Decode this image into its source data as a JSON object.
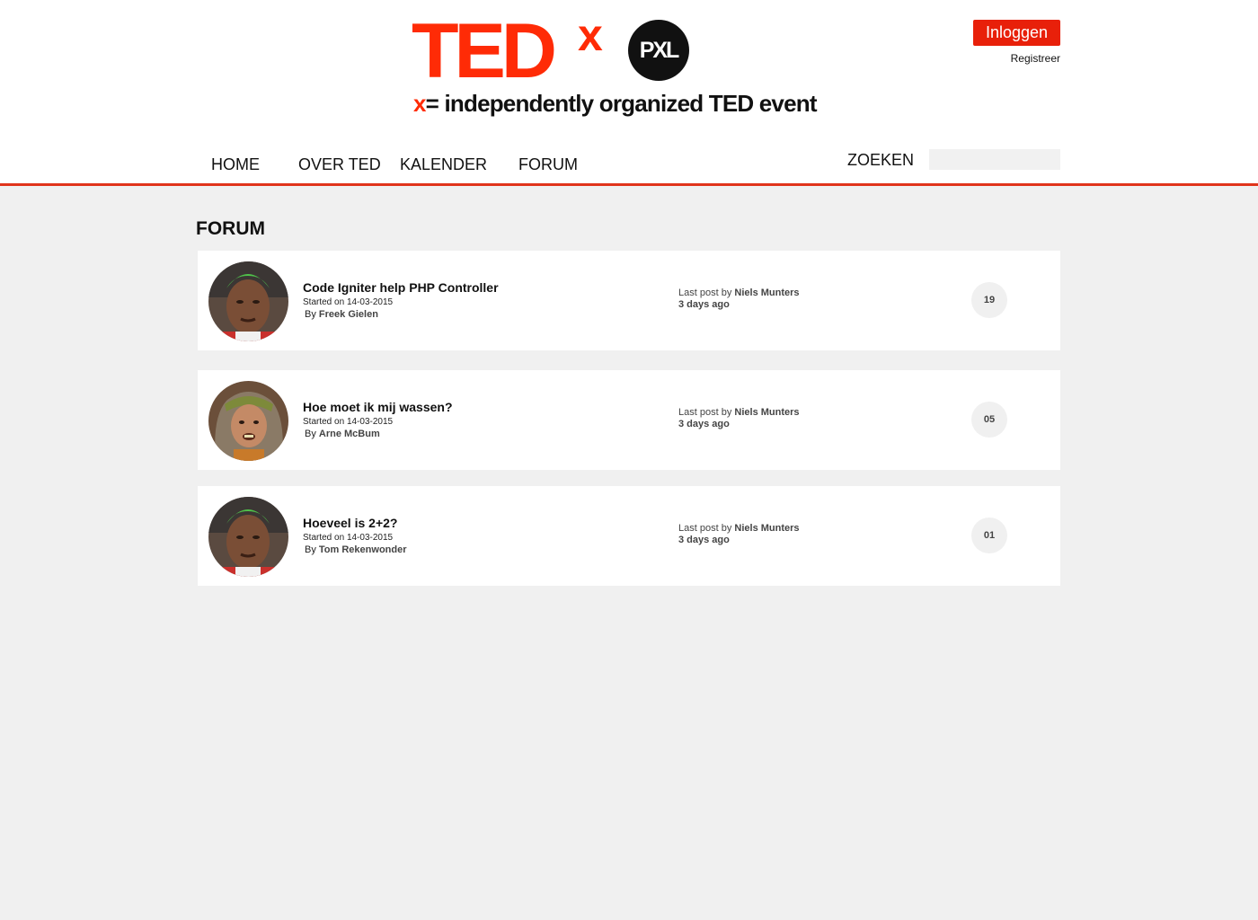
{
  "brand": {
    "logo_main": "TED",
    "logo_superscript": "x",
    "logo_badge": "PXL",
    "tagline_x": "x",
    "tagline_rest": "= independently organized TED event",
    "accent_color": "#ff2b06"
  },
  "auth": {
    "login_label": "Inloggen",
    "register_label": "Registreer"
  },
  "nav": {
    "items": [
      {
        "label": "HOME"
      },
      {
        "label": "OVER TED"
      },
      {
        "label": "KALENDER"
      },
      {
        "label": "FORUM"
      }
    ],
    "search_label": "ZOEKEN",
    "search_value": ""
  },
  "page": {
    "title": "FORUM"
  },
  "threads": [
    {
      "title": "Code Igniter help PHP Controller",
      "started_prefix": "Started on",
      "started_date": "14-03-2015",
      "by_prefix": "By",
      "author": "Freek Gielen",
      "last_post_prefix": "Last post by",
      "last_post_author": "Niels Munters",
      "last_post_ago": "3 days ago",
      "replies": "19",
      "avatar": "green-hair-man"
    },
    {
      "title": "Hoe moet ik mij wassen?",
      "started_prefix": "Started on",
      "started_date": "14-03-2015",
      "by_prefix": "By",
      "author": "Arne McBum",
      "last_post_prefix": "Last post by",
      "last_post_author": "Niels Munters",
      "last_post_ago": "3 days ago",
      "replies": "05",
      "avatar": "long-hair-man"
    },
    {
      "title": "Hoeveel is 2+2?",
      "started_prefix": "Started on",
      "started_date": "14-03-2015",
      "by_prefix": "By",
      "author": "Tom Rekenwonder",
      "last_post_prefix": "Last post by",
      "last_post_author": "Niels Munters",
      "last_post_ago": "3 days ago",
      "replies": "01",
      "avatar": "green-hair-man"
    }
  ]
}
